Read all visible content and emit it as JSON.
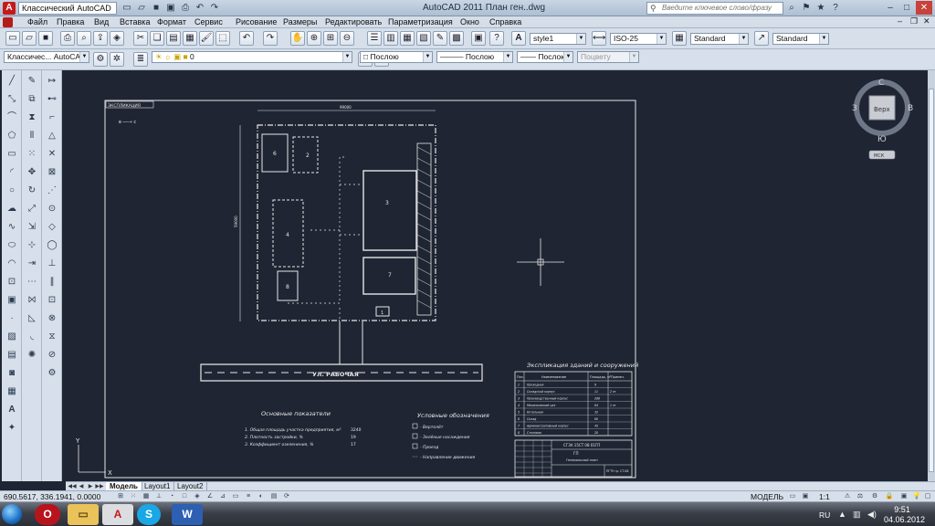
{
  "window": {
    "title": "AutoCAD 2011    План ген..dwg",
    "workspace": "Классический AutoCAD",
    "search_placeholder": "Введите ключевое слово/фразу"
  },
  "menu": [
    "Файл",
    "Правка",
    "Вид",
    "Вставка",
    "Формат",
    "Сервис",
    "Рисование",
    "Размеры",
    "Редактировать",
    "Параметризация",
    "Окно",
    "Справка"
  ],
  "styles_toolbar": {
    "text_style": "style1",
    "dim_style": "ISO-25",
    "table_style": "Standard",
    "multileader_style": "Standard"
  },
  "layers_toolbar": {
    "workspace": "Классичес... AutoCAD",
    "layer": "0",
    "color": "Послою",
    "linetype": "Послою",
    "lineweight": "Послою",
    "plotstyle": "Поцвету"
  },
  "viewcube": {
    "north": "С",
    "south": "Ю",
    "west": "З",
    "east": "В",
    "face": "Верх",
    "ucs": "МСК"
  },
  "drawing": {
    "stamp_title": "ЭКСПЛИКАЦИЯ",
    "north_arrow_label": "в ──→ с",
    "dim_width": "99000",
    "dim_height": "59000",
    "buildings": [
      {
        "label": "6"
      },
      {
        "label": "2"
      },
      {
        "label": "3"
      },
      {
        "label": "4"
      },
      {
        "label": "7"
      },
      {
        "label": "8"
      },
      {
        "label": "1"
      }
    ],
    "street": "УЛ. РАБОЧАЯ",
    "indicators": {
      "title": "Основные показатели",
      "rows": [
        "1. Общая площадь участка предприятия, м²",
        "2. Плотность застройки, %",
        "3. Коэффициент озеленения, %"
      ],
      "values": [
        "3240",
        "19",
        "17"
      ]
    },
    "legend": {
      "title": "Условные обозначения",
      "items": [
        "- Вертолёт",
        "- Зелёные насаждения",
        "- Проезд",
        "- Направление движения"
      ]
    },
    "explication": {
      "title": "Экспликация зданий и сооружений",
      "headers": [
        "Поз.",
        "Наименование",
        "Площадь, м²",
        "Примеч."
      ],
      "rows": [
        {
          "n": "1",
          "name": "Проходная",
          "area": "9",
          "note": ""
        },
        {
          "n": "2",
          "name": "Складской корпус",
          "area": "11",
          "note": "2 эт"
        },
        {
          "n": "3",
          "name": "Производственный корпус",
          "area": "288",
          "note": ""
        },
        {
          "n": "4",
          "name": "Механический цех",
          "area": "84",
          "note": "1 эт"
        },
        {
          "n": "5",
          "name": "Котельная",
          "area": "32",
          "note": ""
        },
        {
          "n": "6",
          "name": "Склад",
          "area": "60",
          "note": ""
        },
        {
          "n": "7",
          "name": "Административный корпус",
          "area": "45",
          "note": ""
        },
        {
          "n": "8",
          "name": "Столовая",
          "area": "20",
          "note": ""
        }
      ]
    },
    "stamp": {
      "code": "СГЗА 15СТ 08 01ГП",
      "sheet": "ГП",
      "name": "Генеральный план",
      "org": "ПГТУ гр. СТ-08"
    }
  },
  "tabs": [
    "Модель",
    "Layout1",
    "Layout2"
  ],
  "status": {
    "coords": "690.5617, 336.1941, 0.0000",
    "mode": "МОДЕЛЬ",
    "scale": "1:1"
  },
  "taskbar": {
    "lang": "RU",
    "time": "9:51",
    "date": "04.06.2012"
  }
}
